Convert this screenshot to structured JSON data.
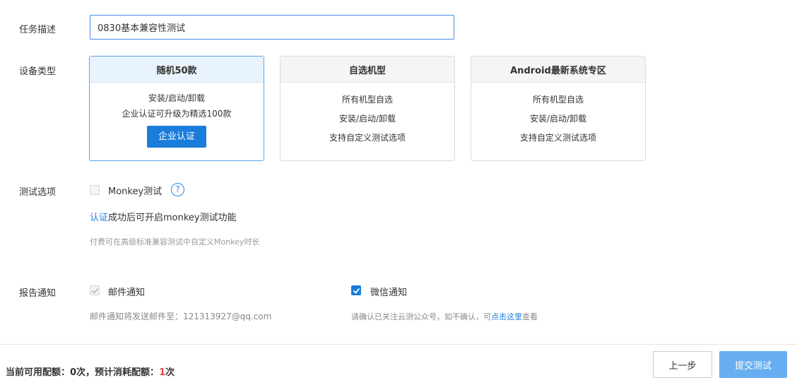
{
  "task": {
    "label": "任务描述",
    "value": "0830基本兼容性测试"
  },
  "device": {
    "label": "设备类型",
    "cards": [
      {
        "title": "随机50款",
        "lines": [
          "安装/启动/卸载",
          "企业认证可升级为精选100款"
        ],
        "button": "企业认证",
        "selected": true
      },
      {
        "title": "自选机型",
        "lines": [
          "所有机型自选",
          "安装/启动/卸载",
          "支持自定义测试选项"
        ],
        "selected": false
      },
      {
        "title": "Android最新系统专区",
        "lines": [
          "所有机型自选",
          "安装/启动/卸载",
          "支持自定义测试选项"
        ],
        "selected": false
      }
    ]
  },
  "options": {
    "label": "测试选项",
    "monkey_label": "Monkey测试",
    "help_icon": "?",
    "auth_link": "认证",
    "auth_rest": "成功后可开启monkey测试功能",
    "paid_hint": "付费可在高级标准兼容测试中自定义Monkey时长"
  },
  "notify": {
    "label": "报告通知",
    "email_label": "邮件通知",
    "email_hint": "邮件通知将发送邮件至：121313927@qq.com",
    "wechat_label": "微信通知",
    "wechat_hint_pre": "请确认已关注云测公众号，如不确认，可",
    "wechat_hint_link": "点击这里",
    "wechat_hint_post": "查看"
  },
  "footer": {
    "quota_prefix": "当前可用配额：",
    "quota_value": "0次，预计消耗配额：",
    "cost_value": "1",
    "cost_unit": "次",
    "prev_button": "上一步",
    "submit_button": "提交测试"
  },
  "colors": {
    "accent": "#1a7ddb",
    "submit_disabled": "#66aef0",
    "cost_red": "#e8453c"
  }
}
